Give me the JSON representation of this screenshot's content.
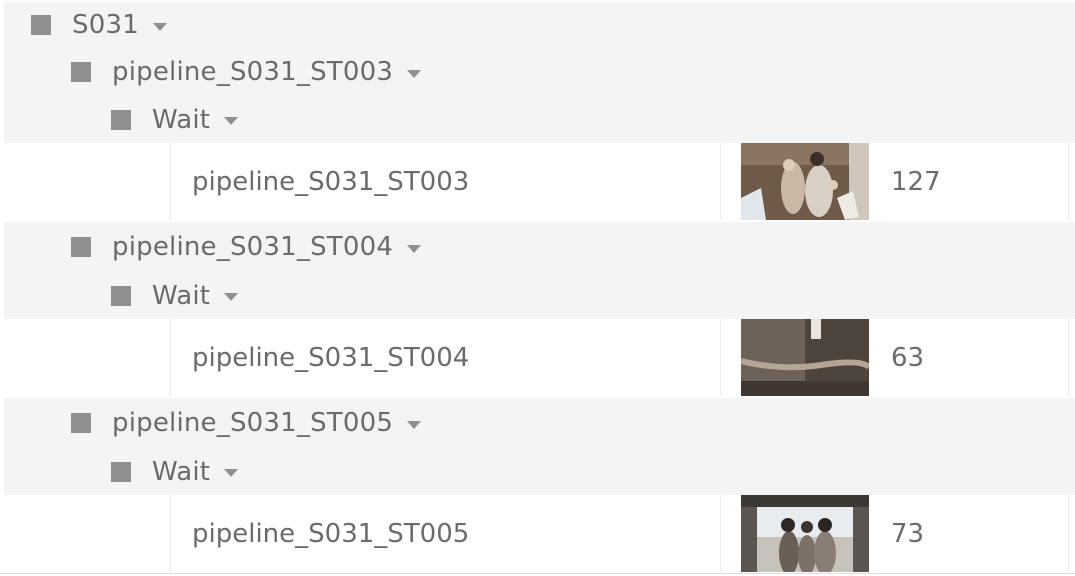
{
  "tree": {
    "sequence": {
      "label": "S031"
    },
    "shots": [
      {
        "shot_label": "pipeline_S031_ST003",
        "status_label": "Wait",
        "item_name": "pipeline_S031_ST003",
        "frame_count": "127",
        "thumb": "thumbnail-image"
      },
      {
        "shot_label": "pipeline_S031_ST004",
        "status_label": "Wait",
        "item_name": "pipeline_S031_ST004",
        "frame_count": "63",
        "thumb": "thumbnail-image"
      },
      {
        "shot_label": "pipeline_S031_ST005",
        "status_label": "Wait",
        "item_name": "pipeline_S031_ST005",
        "frame_count": "73",
        "thumb": "thumbnail-image"
      }
    ]
  },
  "colors": {
    "group_bg": "#f4f4f4",
    "item_bg": "#ffffff",
    "text": "#6b6b6b",
    "icon": "#8f8f8f"
  }
}
